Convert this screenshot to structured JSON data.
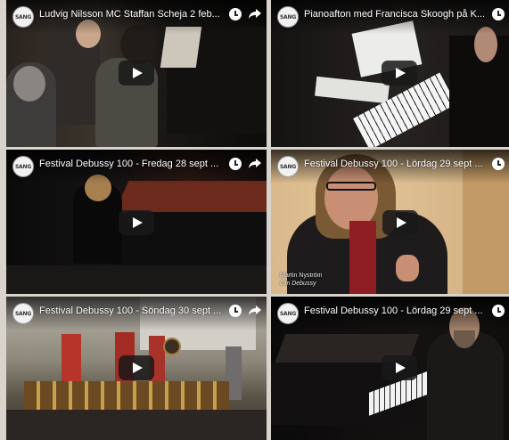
{
  "channel": {
    "logo_text": "SANG"
  },
  "videos": [
    {
      "title": "Ludvig Nilsson MC Staffan Scheja 2 feb..."
    },
    {
      "title": "Pianoafton med Francisca Skoogh på K..."
    },
    {
      "title": "Festival Debussy 100 - Fredag 28 sept ..."
    },
    {
      "title": "Festival Debussy 100 - Lördag 29 sept ...",
      "caption_name": "Martin Nyström",
      "caption_sub": "Om Debussy"
    },
    {
      "title": "Festival Debussy 100 - Söndag 30 sept ..."
    },
    {
      "title": "Festival Debussy 100 - Lördag 29 sept ..."
    }
  ],
  "icons": {
    "clock": "watch-later-icon",
    "share": "share-icon",
    "play": "play-button-icon"
  }
}
